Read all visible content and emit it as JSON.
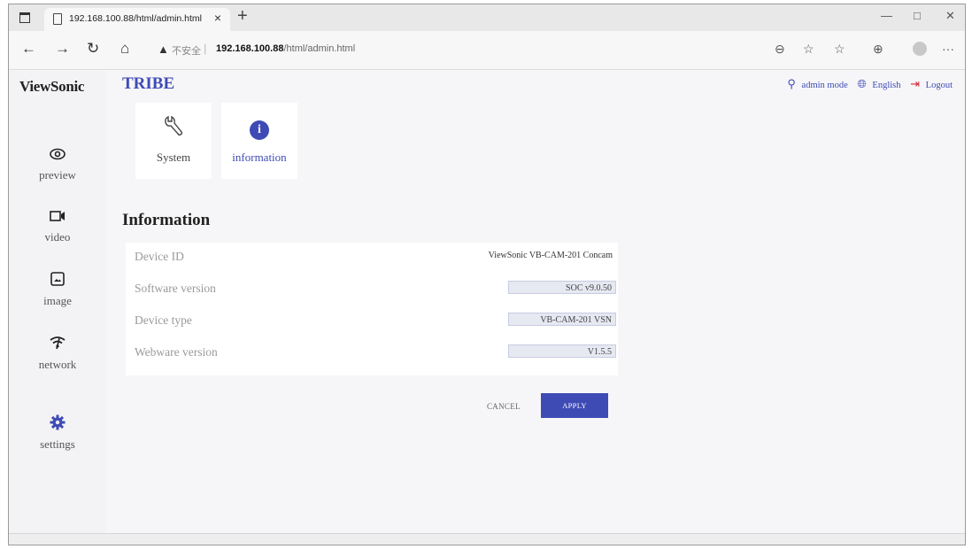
{
  "browser": {
    "tab_title": "192.168.100.88/html/admin.html",
    "tab_close": "×",
    "new_tab": "+",
    "security_label": "不安全",
    "url_host": "192.168.100.88",
    "url_path": "/html/admin.html",
    "window_controls": {
      "minimize": "—",
      "maximize": "□",
      "close": "✕"
    },
    "nav": {
      "back": "←",
      "forward": "→",
      "refresh": "↻",
      "home": "⌂"
    },
    "tools": {
      "zoom": "⊖",
      "favorites_add": "☆",
      "favorites": "☆",
      "collections": "⊕",
      "more": "···"
    }
  },
  "app": {
    "brand": "ViewSonic",
    "product": "TRIBE",
    "top_right": {
      "admin": "admin mode",
      "language": "English",
      "logout": "Logout"
    }
  },
  "sidebar": {
    "items": [
      {
        "label": "preview",
        "icon": "eye-icon"
      },
      {
        "label": "video",
        "icon": "video-camera-icon"
      },
      {
        "label": "image",
        "icon": "image-icon"
      },
      {
        "label": "network",
        "icon": "wifi-icon"
      },
      {
        "label": "settings",
        "icon": "gear-icon"
      }
    ]
  },
  "settings_tabs": [
    {
      "label": "System",
      "icon": "wrench-icon"
    },
    {
      "label": "information",
      "icon": "info-icon"
    }
  ],
  "information": {
    "title": "Information",
    "rows": [
      {
        "label": "Device ID",
        "value": "ViewSonic VB-CAM-201 Concam"
      },
      {
        "label": "Software version",
        "value": "SOC v9.0.50"
      },
      {
        "label": "Device type",
        "value": "VB-CAM-201 VSN"
      },
      {
        "label": "Webware version",
        "value": "V1.5.5"
      }
    ]
  },
  "actions": {
    "cancel": "CANCEL",
    "apply": "APPLY"
  },
  "colors": {
    "accent": "#3f4bb5",
    "logout": "#d7263d"
  }
}
